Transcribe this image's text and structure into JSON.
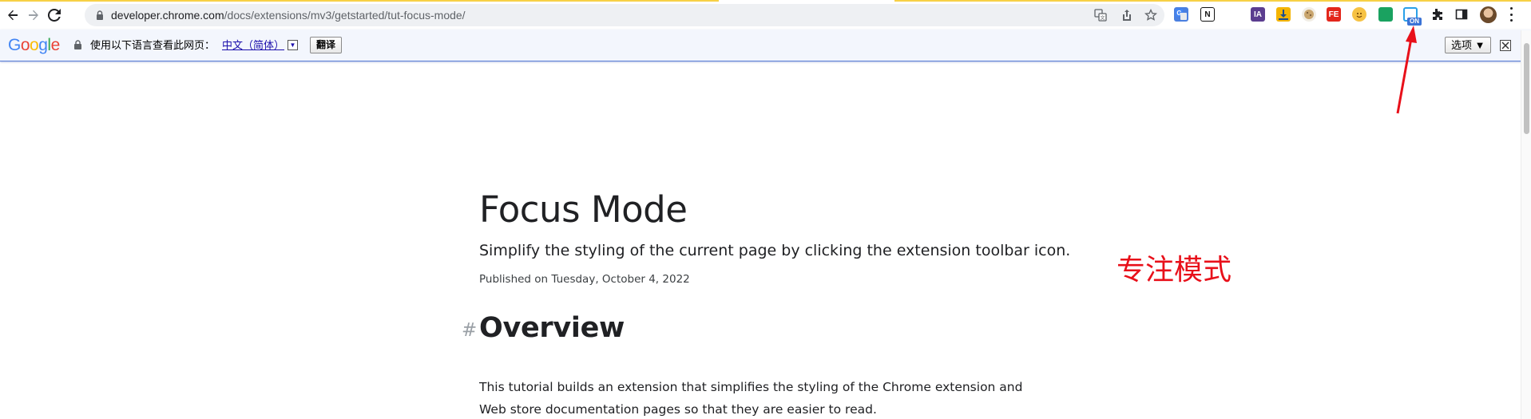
{
  "browser": {
    "url_host": "developer.chrome.com",
    "url_path": "/docs/extensions/mv3/getstarted/tut-focus-mode/",
    "extensions": {
      "on_badge": "ON",
      "ia_label": "IA",
      "fe_label": "FE"
    }
  },
  "translate_bar": {
    "logo": {
      "g1": "G",
      "o1": "o",
      "o2": "o",
      "g2": "g",
      "l": "l",
      "e": "e"
    },
    "prompt": "使用以下语言查看此网页：",
    "language": "中文（简体）",
    "dropdown_glyph": "▼",
    "translate_button": "翻译",
    "options_button": "选项 ▼"
  },
  "page": {
    "title": "Focus Mode",
    "subtitle": "Simplify the styling of the current page by clicking the extension toolbar icon.",
    "published": "Published on Tuesday, October 4, 2022",
    "anchor": "#",
    "section_heading": "Overview",
    "paragraph": "This tutorial builds an extension that simplifies the styling of the Chrome extension and Web store documentation pages so that they are easier to read."
  },
  "annotation": {
    "text": "专注模式",
    "color": "#e8101a"
  },
  "colors": {
    "translate_bar_bg": "#f3f6fd",
    "link": "#1a0dab",
    "omnibox_bg": "#eef0f3"
  }
}
